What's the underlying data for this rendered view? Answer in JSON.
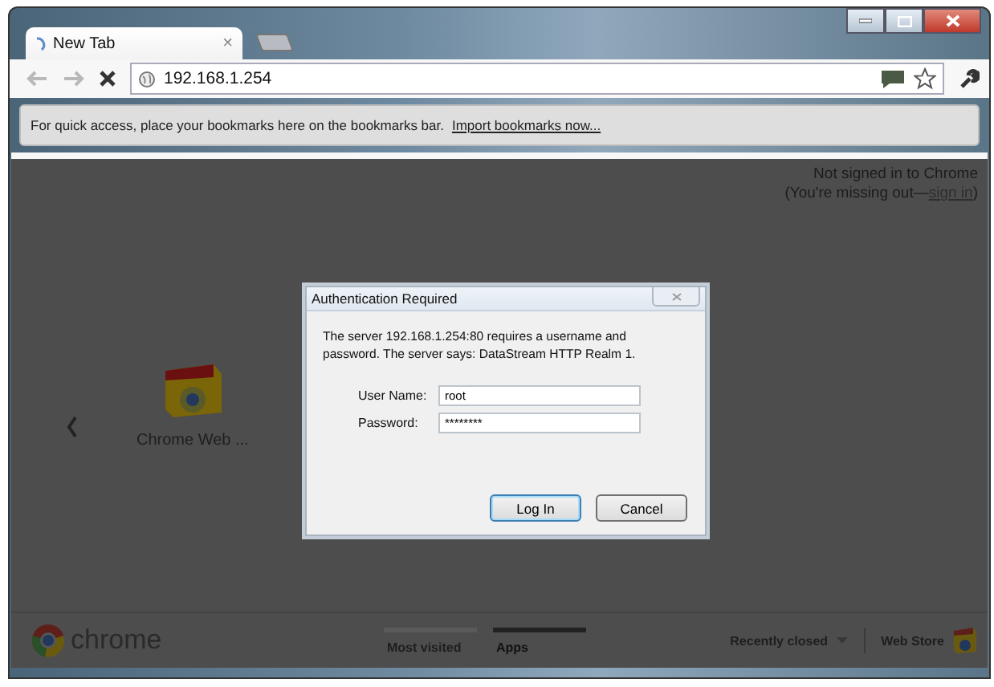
{
  "tabs": [
    {
      "title": "New Tab",
      "close": "×",
      "selected": true
    }
  ],
  "toolbar": {
    "address": "192.168.1.254"
  },
  "bookmarks_bar": {
    "message": "For quick access, place your bookmarks here on the bookmarks bar.",
    "link": "Import bookmarks now..."
  },
  "sign_in": {
    "line1": "Not signed in to Chrome",
    "prefix": "(You're missing out—",
    "link": "sign in",
    "suffix": ")"
  },
  "apps": [
    {
      "label": "Chrome Web ..."
    }
  ],
  "footer": {
    "logo": "chrome",
    "tabs": [
      {
        "label": "Most visited",
        "selected": false
      },
      {
        "label": "Apps",
        "selected": true
      }
    ],
    "recently_closed": "Recently closed",
    "web_store": "Web Store"
  },
  "dialog": {
    "title": "Authentication Required",
    "message": "The server 192.168.1.254:80 requires a username and password. The server says: DataStream HTTP Realm 1.",
    "fields": [
      {
        "label": "User Name:",
        "value": "root"
      },
      {
        "label": "Password:",
        "value": "********"
      }
    ],
    "buttons": [
      "Log In",
      "Cancel"
    ]
  }
}
